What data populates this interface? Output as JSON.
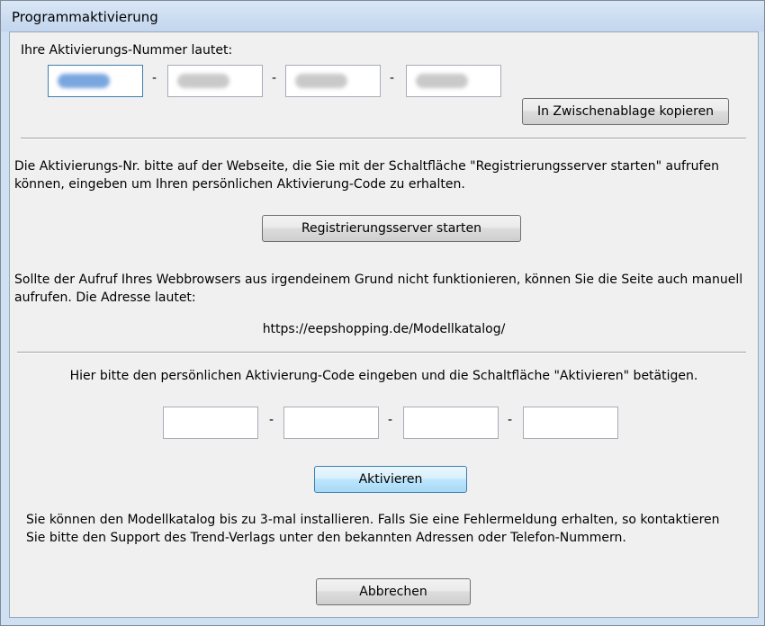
{
  "window": {
    "title": "Programmaktivierung"
  },
  "activation_number": {
    "label": "Ihre Aktivierungs-Nummer lautet:",
    "separator": "-",
    "copy_button": "In Zwischenablage kopieren"
  },
  "instructions": {
    "text": "Die Aktivierungs-Nr. bitte auf der Webseite, die Sie mit der Schaltfläche \"Registrierungsserver starten\" aufrufen können, eingeben um Ihren persönlichen Aktivierung-Code zu erhalten.",
    "start_server_button": "Registrierungsserver starten",
    "manual_text": "Sollte  der Aufruf Ihres Webbrowsers aus irgendeinem Grund nicht funktionieren, können Sie die Seite auch manuell aufrufen. Die Adresse lautet:",
    "url": "https://eepshopping.de/Modellkatalog/"
  },
  "activation_code": {
    "label": "Hier bitte den persönlichen Aktivierung-Code eingeben und die Schaltfläche \"Aktivieren\" betätigen.",
    "separator": "-",
    "fields": [
      "",
      "",
      "",
      ""
    ],
    "activate_button": "Aktivieren"
  },
  "footer": {
    "info_text": "Sie können den Modellkatalog bis zu 3-mal installieren. Falls Sie eine Fehlermeldung erhalten, so kontaktieren Sie bitte den Support des Trend-Verlags unter den bekannten Adressen oder Telefon-Nummern.",
    "cancel_button": "Abbrechen"
  }
}
